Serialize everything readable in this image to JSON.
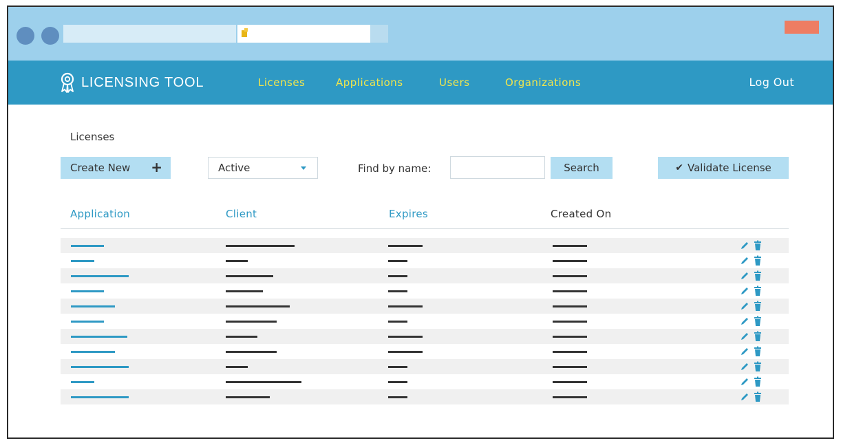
{
  "app": {
    "brand": "LICENSING TOOL",
    "nav": [
      "Licenses",
      "Applications",
      "Users",
      "Organizations"
    ],
    "logout": "Log Out"
  },
  "page": {
    "title": "Licenses",
    "create_button": "Create New",
    "status_filter": "Active",
    "find_label": "Find by name:",
    "search_value": "",
    "search_button": "Search",
    "validate_button": "Validate License"
  },
  "table": {
    "columns": [
      "Application",
      "Client",
      "Expires",
      "Created On"
    ],
    "rows": [
      {
        "placeholder": true
      },
      {
        "placeholder": true
      },
      {
        "placeholder": true
      },
      {
        "placeholder": true
      },
      {
        "placeholder": true
      },
      {
        "placeholder": true
      },
      {
        "placeholder": true
      },
      {
        "placeholder": true
      },
      {
        "placeholder": true
      },
      {
        "placeholder": true
      },
      {
        "placeholder": true
      }
    ]
  },
  "colors": {
    "chrome": "#9dd0ec",
    "navbar": "#2e99c4",
    "nav_link": "#f1e64d",
    "button": "#b3def2",
    "accent": "#2e99c4",
    "close_button": "#ee7d63"
  },
  "icons": {
    "brand": "award-ribbon-icon",
    "create": "plus-icon",
    "dropdown": "chevron-down-icon",
    "validate": "checkmark-icon",
    "row_edit": "pencil-icon",
    "row_delete": "trash-icon"
  }
}
